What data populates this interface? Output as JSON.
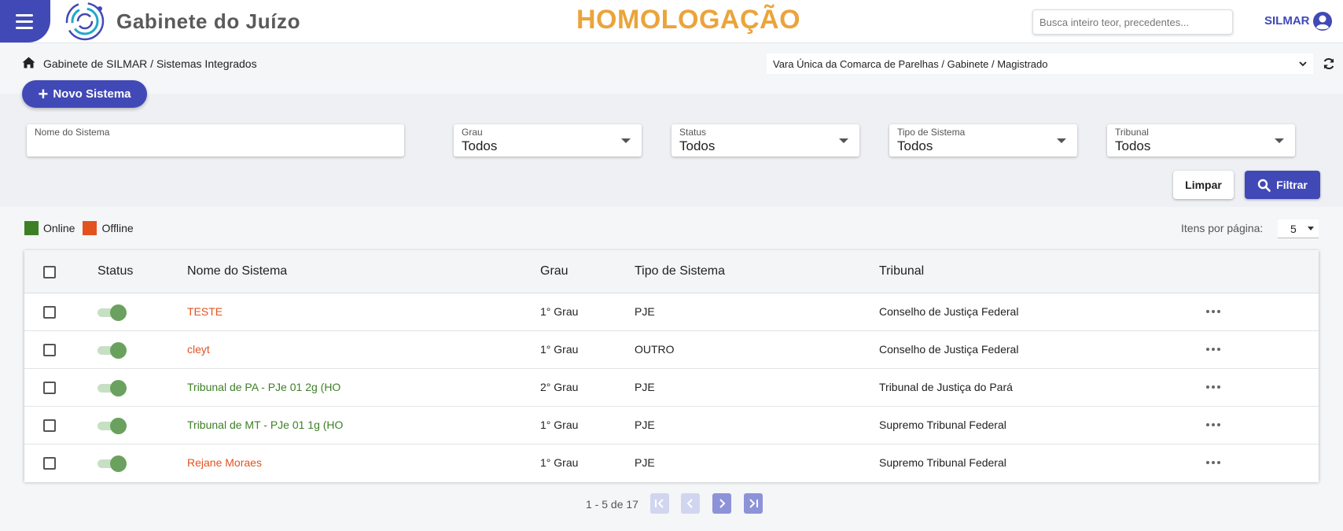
{
  "header": {
    "app_title": "Gabinete do Juízo",
    "environment": "HOMOLOGAÇÃO",
    "search_placeholder": "Busca inteiro teor, precedentes...",
    "user_name": "SILMAR"
  },
  "breadcrumb": "Gabinete de SILMAR / Sistemas Integrados",
  "unit_selector": "Vara Única da Comarca de Parelhas / Gabinete / Magistrado",
  "new_button_label": "Novo Sistema",
  "filters": {
    "name": {
      "label": "Nome do Sistema",
      "value": ""
    },
    "grau": {
      "label": "Grau",
      "value": "Todos"
    },
    "status": {
      "label": "Status",
      "value": "Todos"
    },
    "tipo": {
      "label": "Tipo de Sistema",
      "value": "Todos"
    },
    "tribunal": {
      "label": "Tribunal",
      "value": "Todos"
    },
    "clear_label": "Limpar",
    "filter_label": "Filtrar"
  },
  "legend": {
    "online": "Online",
    "offline": "Offline"
  },
  "colors": {
    "primary": "#4149b7",
    "online": "#3e7f26",
    "offline": "#e2521f",
    "environment": "#eba43a"
  },
  "items_per_page_label": "Itens por página:",
  "items_per_page": "5",
  "table": {
    "columns": [
      "Status",
      "Nome do Sistema",
      "Grau",
      "Tipo de Sistema",
      "Tribunal"
    ],
    "rows": [
      {
        "name": "TESTE",
        "name_status": "offline",
        "grau": "1° Grau",
        "tipo": "PJE",
        "tribunal": "Conselho de Justiça Federal",
        "active": true
      },
      {
        "name": "cleyt",
        "name_status": "offline",
        "grau": "1° Grau",
        "tipo": "OUTRO",
        "tribunal": "Conselho de Justiça Federal",
        "active": true
      },
      {
        "name": "Tribunal de PA - PJe 01 2g (HO",
        "name_status": "online",
        "grau": "2° Grau",
        "tipo": "PJE",
        "tribunal": "Tribunal de Justiça do Pará",
        "active": true
      },
      {
        "name": "Tribunal de MT - PJe 01 1g (HO",
        "name_status": "online",
        "grau": "1° Grau",
        "tipo": "PJE",
        "tribunal": "Supremo Tribunal Federal",
        "active": true
      },
      {
        "name": "Rejane Moraes",
        "name_status": "offline",
        "grau": "1° Grau",
        "tipo": "PJE",
        "tribunal": "Supremo Tribunal Federal",
        "active": true
      }
    ]
  },
  "pagination": {
    "range": "1 - 5 de 17"
  }
}
